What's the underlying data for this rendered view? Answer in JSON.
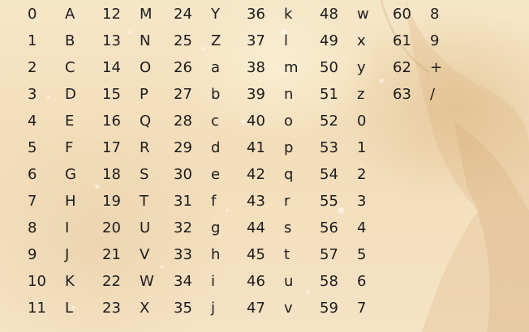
{
  "table": {
    "columns": [
      {
        "cells": [
          {
            "index": "0",
            "char": "A"
          },
          {
            "index": "1",
            "char": "B"
          },
          {
            "index": "2",
            "char": "C"
          },
          {
            "index": "3",
            "char": "D"
          },
          {
            "index": "4",
            "char": "E"
          },
          {
            "index": "5",
            "char": "F"
          },
          {
            "index": "6",
            "char": "G"
          },
          {
            "index": "7",
            "char": "H"
          },
          {
            "index": "8",
            "char": "I"
          },
          {
            "index": "9",
            "char": "J"
          },
          {
            "index": "10",
            "char": "K"
          },
          {
            "index": "11",
            "char": "L"
          }
        ]
      },
      {
        "cells": [
          {
            "index": "12",
            "char": "M"
          },
          {
            "index": "13",
            "char": "N"
          },
          {
            "index": "14",
            "char": "O"
          },
          {
            "index": "15",
            "char": "P"
          },
          {
            "index": "16",
            "char": "Q"
          },
          {
            "index": "17",
            "char": "R"
          },
          {
            "index": "18",
            "char": "S"
          },
          {
            "index": "19",
            "char": "T"
          },
          {
            "index": "20",
            "char": "U"
          },
          {
            "index": "21",
            "char": "V"
          },
          {
            "index": "22",
            "char": "W"
          },
          {
            "index": "23",
            "char": "X"
          }
        ]
      },
      {
        "cells": [
          {
            "index": "24",
            "char": "Y"
          },
          {
            "index": "25",
            "char": "Z"
          },
          {
            "index": "26",
            "char": "a"
          },
          {
            "index": "27",
            "char": "b"
          },
          {
            "index": "28",
            "char": "c"
          },
          {
            "index": "29",
            "char": "d"
          },
          {
            "index": "30",
            "char": "e"
          },
          {
            "index": "31",
            "char": "f"
          },
          {
            "index": "32",
            "char": "g"
          },
          {
            "index": "33",
            "char": "h"
          },
          {
            "index": "34",
            "char": "i"
          },
          {
            "index": "35",
            "char": "j"
          }
        ]
      },
      {
        "cells": [
          {
            "index": "36",
            "char": "k"
          },
          {
            "index": "37",
            "char": "l"
          },
          {
            "index": "38",
            "char": "m"
          },
          {
            "index": "39",
            "char": "n"
          },
          {
            "index": "40",
            "char": "o"
          },
          {
            "index": "41",
            "char": "p"
          },
          {
            "index": "42",
            "char": "q"
          },
          {
            "index": "43",
            "char": "r"
          },
          {
            "index": "44",
            "char": "s"
          },
          {
            "index": "45",
            "char": "t"
          },
          {
            "index": "46",
            "char": "u"
          },
          {
            "index": "47",
            "char": "v"
          }
        ]
      },
      {
        "cells": [
          {
            "index": "48",
            "char": "w"
          },
          {
            "index": "49",
            "char": "x"
          },
          {
            "index": "50",
            "char": "y"
          },
          {
            "index": "51",
            "char": "z"
          },
          {
            "index": "52",
            "char": "0"
          },
          {
            "index": "53",
            "char": "1"
          },
          {
            "index": "54",
            "char": "2"
          },
          {
            "index": "55",
            "char": "3"
          },
          {
            "index": "56",
            "char": "4"
          },
          {
            "index": "57",
            "char": "5"
          },
          {
            "index": "58",
            "char": "6"
          },
          {
            "index": "59",
            "char": "7"
          }
        ]
      },
      {
        "cells": [
          {
            "index": "60",
            "char": "8"
          },
          {
            "index": "61",
            "char": "9"
          },
          {
            "index": "62",
            "char": "+"
          },
          {
            "index": "63",
            "char": "/"
          }
        ]
      }
    ]
  },
  "colors": {
    "text": "#1c1c1c",
    "background": "#f4e1c0"
  }
}
